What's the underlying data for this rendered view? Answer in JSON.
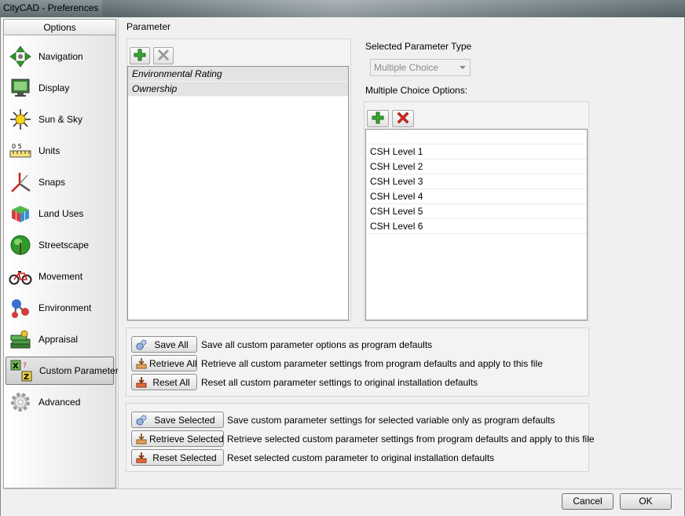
{
  "window": {
    "title": "CityCAD - Preferences"
  },
  "nav": {
    "header": "Options",
    "items": [
      {
        "label": "Navigation",
        "icon": "navigation-arrows-icon"
      },
      {
        "label": "Display",
        "icon": "display-monitor-icon"
      },
      {
        "label": "Sun & Sky",
        "icon": "sun-icon"
      },
      {
        "label": "Units",
        "icon": "ruler-units-icon"
      },
      {
        "label": "Snaps",
        "icon": "snaps-axes-icon"
      },
      {
        "label": "Land Uses",
        "icon": "land-use-blocks-icon"
      },
      {
        "label": "Streetscape",
        "icon": "tree-icon"
      },
      {
        "label": "Movement",
        "icon": "bicycle-icon"
      },
      {
        "label": "Environment",
        "icon": "molecule-icon"
      },
      {
        "label": "Appraisal",
        "icon": "money-stack-icon"
      },
      {
        "label": "Custom Parameters",
        "icon": "custom-parameters-icon",
        "selected": true
      },
      {
        "label": "Advanced",
        "icon": "gear-icon"
      }
    ]
  },
  "parameter": {
    "heading": "Parameter",
    "items": [
      "Environmental Rating",
      "Ownership"
    ]
  },
  "type": {
    "heading": "Selected Parameter Type",
    "value": "Multiple Choice"
  },
  "options": {
    "heading": "Multiple Choice Options:",
    "items": [
      "",
      "CSH Level 1",
      "CSH Level 2",
      "CSH Level 3",
      "CSH Level 4",
      "CSH Level 5",
      "CSH Level 6"
    ]
  },
  "all_actions": [
    {
      "label": "Save All",
      "desc": "Save all custom parameter options as program defaults"
    },
    {
      "label": "Retrieve All",
      "desc": "Retrieve all custom parameter settings from program defaults and apply to this file"
    },
    {
      "label": "Reset All",
      "desc": "Reset all custom parameter settings to original installation defaults"
    }
  ],
  "selected_actions": [
    {
      "label": "Save Selected",
      "desc": "Save custom parameter settings for selected variable only as program defaults"
    },
    {
      "label": "Retrieve Selected",
      "desc": "Retrieve selected custom parameter settings from program defaults and apply to this file"
    },
    {
      "label": "Reset Selected",
      "desc": "Reset selected custom parameter to original installation defaults"
    }
  ],
  "footer": {
    "cancel": "Cancel",
    "ok": "OK"
  },
  "colors": {
    "add": "#3aa635",
    "delete": "#d42a1e",
    "disabled": "#9a9a9a"
  }
}
